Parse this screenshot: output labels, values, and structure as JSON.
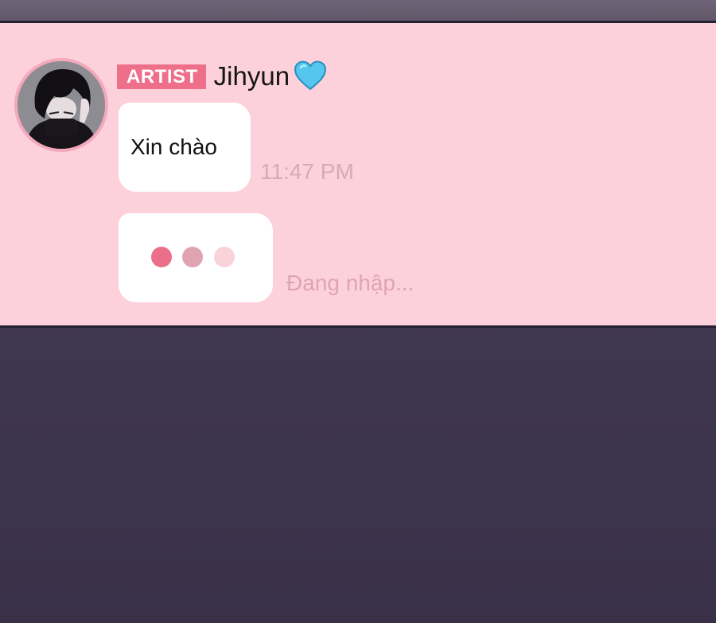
{
  "sender": {
    "role_badge": "ARTIST",
    "name": "Jihyun",
    "heart_icon": "blue-heart-icon",
    "avatar_icon": "avatar-dark-hair-person"
  },
  "messages": [
    {
      "text": "Xin chào",
      "time": "11:47 PM"
    }
  ],
  "typing": {
    "status_text": "Đang nhập...",
    "dot_colors": [
      "#ec6f89",
      "#dfa3b1",
      "#f9d3dc"
    ]
  },
  "colors": {
    "panel_background": "#fdd1dc",
    "badge_background": "#ee6f8a",
    "page_background": "#3f3650"
  }
}
